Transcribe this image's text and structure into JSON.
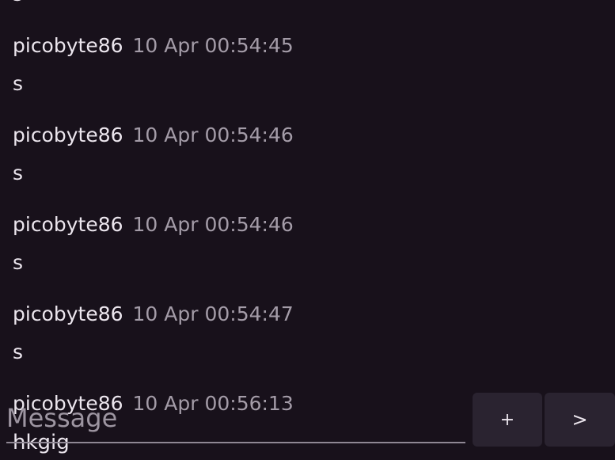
{
  "messages": [
    {
      "author": "picobyte86",
      "time": "10 Apr 00:54:45",
      "text": "s"
    },
    {
      "author": "picobyte86",
      "time": "10 Apr 00:54:46",
      "text": "s"
    },
    {
      "author": "picobyte86",
      "time": "10 Apr 00:54:46",
      "text": "s"
    },
    {
      "author": "picobyte86",
      "time": "10 Apr 00:54:47",
      "text": "s"
    },
    {
      "author": "picobyte86",
      "time": "10 Apr 00:56:13",
      "text": "hkgig"
    }
  ],
  "clipped_top_text": "s",
  "composer": {
    "placeholder": "Message",
    "plus_label": "+",
    "send_label": ">"
  },
  "colors": {
    "background": "#18111b",
    "button": "#2a2330",
    "muted_text": "#a49ca8"
  }
}
